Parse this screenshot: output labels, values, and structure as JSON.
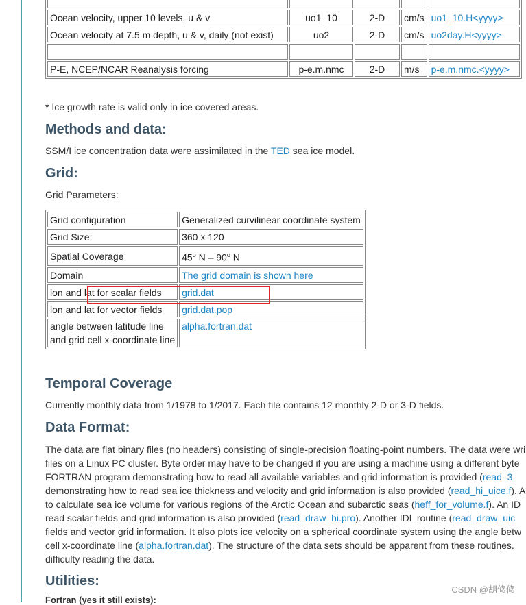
{
  "variables_table": {
    "rows": [
      [
        "Ocean velocity, upper 10 levels, u & v",
        "uo1_10",
        "2-D",
        "cm/s",
        "uo1_10.H<yyyy>"
      ],
      [
        "Ocean velocity at 7.5 m depth, u & v, daily (not exist)",
        "uo2",
        "2-D",
        "cm/s",
        "uo2day.H<yyyy>"
      ],
      [
        "",
        "",
        "",
        "",
        ""
      ],
      [
        "P-E, NCEP/NCAR Reanalysis forcing",
        "p-e.m.nmc",
        "2-D",
        "m/s",
        "p-e.m.nmc.<yyyy>"
      ]
    ]
  },
  "footnote": "* Ice growth rate is valid only in ice covered areas.",
  "methods": {
    "heading": "Methods and data:",
    "text_before": "SSM/I ice concentration data were assimilated in the ",
    "link": "TED",
    "text_after": " sea ice model."
  },
  "grid": {
    "heading": "Grid:",
    "intro": "Grid Parameters:",
    "rows": [
      {
        "label": "Grid configuration",
        "value": "Generalized curvilinear coordinate system"
      },
      {
        "label": "Grid Size:",
        "value": "360 x 120"
      },
      {
        "label": "Spatial Coverage",
        "value_a": "45",
        "deg1": "o",
        "value_b": " N – 90",
        "deg2": "o",
        "value_c": " N"
      },
      {
        "label": "Domain",
        "link": "The grid domain is shown here"
      },
      {
        "label": "lon and lat for scalar fields",
        "link": "grid.dat"
      },
      {
        "label": "lon and lat for vector fields",
        "link": "grid.dat.pop"
      },
      {
        "label_line1": "angle between latitude line",
        "label_line2": "and  grid cell x-coordinate line",
        "link": "alpha.fortran.dat"
      }
    ]
  },
  "temporal": {
    "heading": "Temporal Coverage",
    "text": "Currently monthly data  from 1/1978 to 1/2017. Each file contains 12 monthly 2-D or 3-D fields."
  },
  "data_format": {
    "heading": "Data Format:",
    "lines": [
      {
        "parts": [
          {
            "t": "The data are flat binary files (no headers) consisting of single-precision floating-point numbers. The data were wri"
          }
        ]
      },
      {
        "parts": [
          {
            "t": "files on a Linux PC cluster. Byte order may have to be changed if you are using a machine using a different byte"
          }
        ]
      },
      {
        "parts": [
          {
            "t": "FORTRAN program demonstrating how to read all available variables and grid information is provided ("
          },
          {
            "l": "read_3"
          }
        ]
      },
      {
        "parts": [
          {
            "t": "demonstrating how to read sea ice thickness and velocity and grid information is also provided ("
          },
          {
            "l": "read_hi_uice.f"
          },
          {
            "t": "). A"
          }
        ]
      },
      {
        "parts": [
          {
            "t": "to calculate sea ice volume for various regions of the Arctic Ocean and subarctic seas ("
          },
          {
            "l": "heff_for_volume.f"
          },
          {
            "t": "). An ID"
          }
        ]
      },
      {
        "parts": [
          {
            "t": "read scalar fields and grid information is also provided ("
          },
          {
            "l": "read_draw_hi.pro"
          },
          {
            "t": "). Another IDL routine ("
          },
          {
            "l": "read_draw_uic"
          }
        ]
      },
      {
        "parts": [
          {
            "t": "fields and vector grid information. It also plots ice velocity on a spherical coordinate system using the angle betw"
          }
        ]
      },
      {
        "parts": [
          {
            "t": "cell x-coordinate line ("
          },
          {
            "l": "alpha.fortran.dat"
          },
          {
            "t": "). The structure of the data sets should be apparent from these routines."
          }
        ]
      },
      {
        "parts": [
          {
            "t": "difficulty reading the data."
          }
        ]
      }
    ]
  },
  "utilities": {
    "heading": "Utilities:",
    "cut_text": "Fortran (yes it still exists):"
  },
  "watermark": "CSDN @胡修修"
}
